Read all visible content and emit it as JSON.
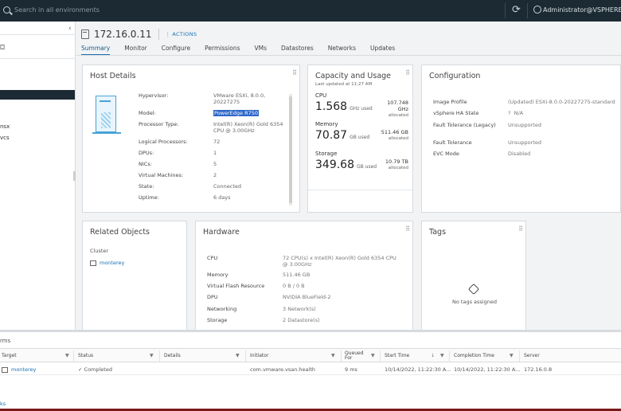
{
  "topbar": {
    "search_placeholder": "Search in all environments",
    "user": "Administrator@VSPHERE.LO"
  },
  "leftnav": {
    "item_sx": "nsx",
    "item_vcs": "vcs"
  },
  "host": {
    "title": "172.16.0.11",
    "actions_label": "ACTIONS"
  },
  "tabs": [
    "Summary",
    "Monitor",
    "Configure",
    "Permissions",
    "VMs",
    "Datastores",
    "Networks",
    "Updates"
  ],
  "host_details": {
    "title": "Host Details",
    "rows": [
      {
        "k": "Hypervisor:",
        "v": "VMware ESXi, 8.0.0, 20227275"
      },
      {
        "k": "Model:",
        "v": "PowerEdge R750"
      },
      {
        "k": "Processor Type:",
        "v": "Intel(R) Xeon(R) Gold 6354 CPU @ 3.00GHz"
      },
      {
        "k": "Logical Processors:",
        "v": "72"
      },
      {
        "k": "DPUs:",
        "v": "1"
      },
      {
        "k": "NICs:",
        "v": "5"
      },
      {
        "k": "Virtual Machines:",
        "v": "2"
      },
      {
        "k": "State:",
        "v": "Connected"
      },
      {
        "k": "Uptime:",
        "v": "6 days"
      }
    ]
  },
  "capacity": {
    "title": "Capacity and Usage",
    "updated": "Last updated at 11:27 AM",
    "cpu": {
      "label": "CPU",
      "value": "1.568",
      "unit": "GHz used",
      "alloc": "107.748 GHz",
      "alloc_label": "allocated"
    },
    "memory": {
      "label": "Memory",
      "value": "70.87",
      "unit": "GB used",
      "alloc": "511.46 GB",
      "alloc_label": "allocated"
    },
    "storage": {
      "label": "Storage",
      "value": "349.68",
      "unit": "GB used",
      "alloc": "10.79 TB",
      "alloc_label": "allocated"
    }
  },
  "configuration": {
    "title": "Configuration",
    "rows": [
      {
        "k": "Image Profile",
        "v": "(Updated) ESXi-8.0.0-20227275-standard"
      },
      {
        "k": "vSphere HA State",
        "v": "N/A"
      },
      {
        "k": "Fault Tolerance (Legacy)",
        "v": "Unsupported"
      },
      {
        "k": "Fault Tolerance",
        "v": "Unsupported"
      },
      {
        "k": "EVC Mode",
        "v": "Disabled"
      }
    ]
  },
  "related": {
    "title": "Related Objects",
    "cluster_label": "Cluster",
    "cluster_link": "monterey"
  },
  "hardware": {
    "title": "Hardware",
    "rows": [
      {
        "k": "CPU",
        "v": "72 CPU(s) x Intel(R) Xeon(R) Gold 6354 CPU @ 3.00GHz"
      },
      {
        "k": "Memory",
        "v": "511.46 GB"
      },
      {
        "k": "Virtual Flash Resource",
        "v": "0 B / 0 B"
      },
      {
        "k": "DPU",
        "v": "NVIDIA BlueField-2"
      },
      {
        "k": "Networking",
        "v": "3 Network(s)"
      },
      {
        "k": "Storage",
        "v": "2 Datastore(s)"
      }
    ]
  },
  "tags": {
    "title": "Tags",
    "empty": "No tags assigned"
  },
  "alarms": {
    "title": "rms",
    "columns": [
      "Target",
      "Status",
      "Details",
      "Initiator",
      "Queued For",
      "Start Time",
      "Completion Time",
      "Server"
    ],
    "row": {
      "target": "monterey",
      "status": "Completed",
      "details": "",
      "initiator": "com.vmware.vsan.health",
      "queued": "9 ms",
      "start": "10/14/2022, 11:22:30 A...",
      "completion": "10/14/2022, 11:22:30 A...",
      "server": "172.16.0.8"
    },
    "footer": "ks"
  }
}
